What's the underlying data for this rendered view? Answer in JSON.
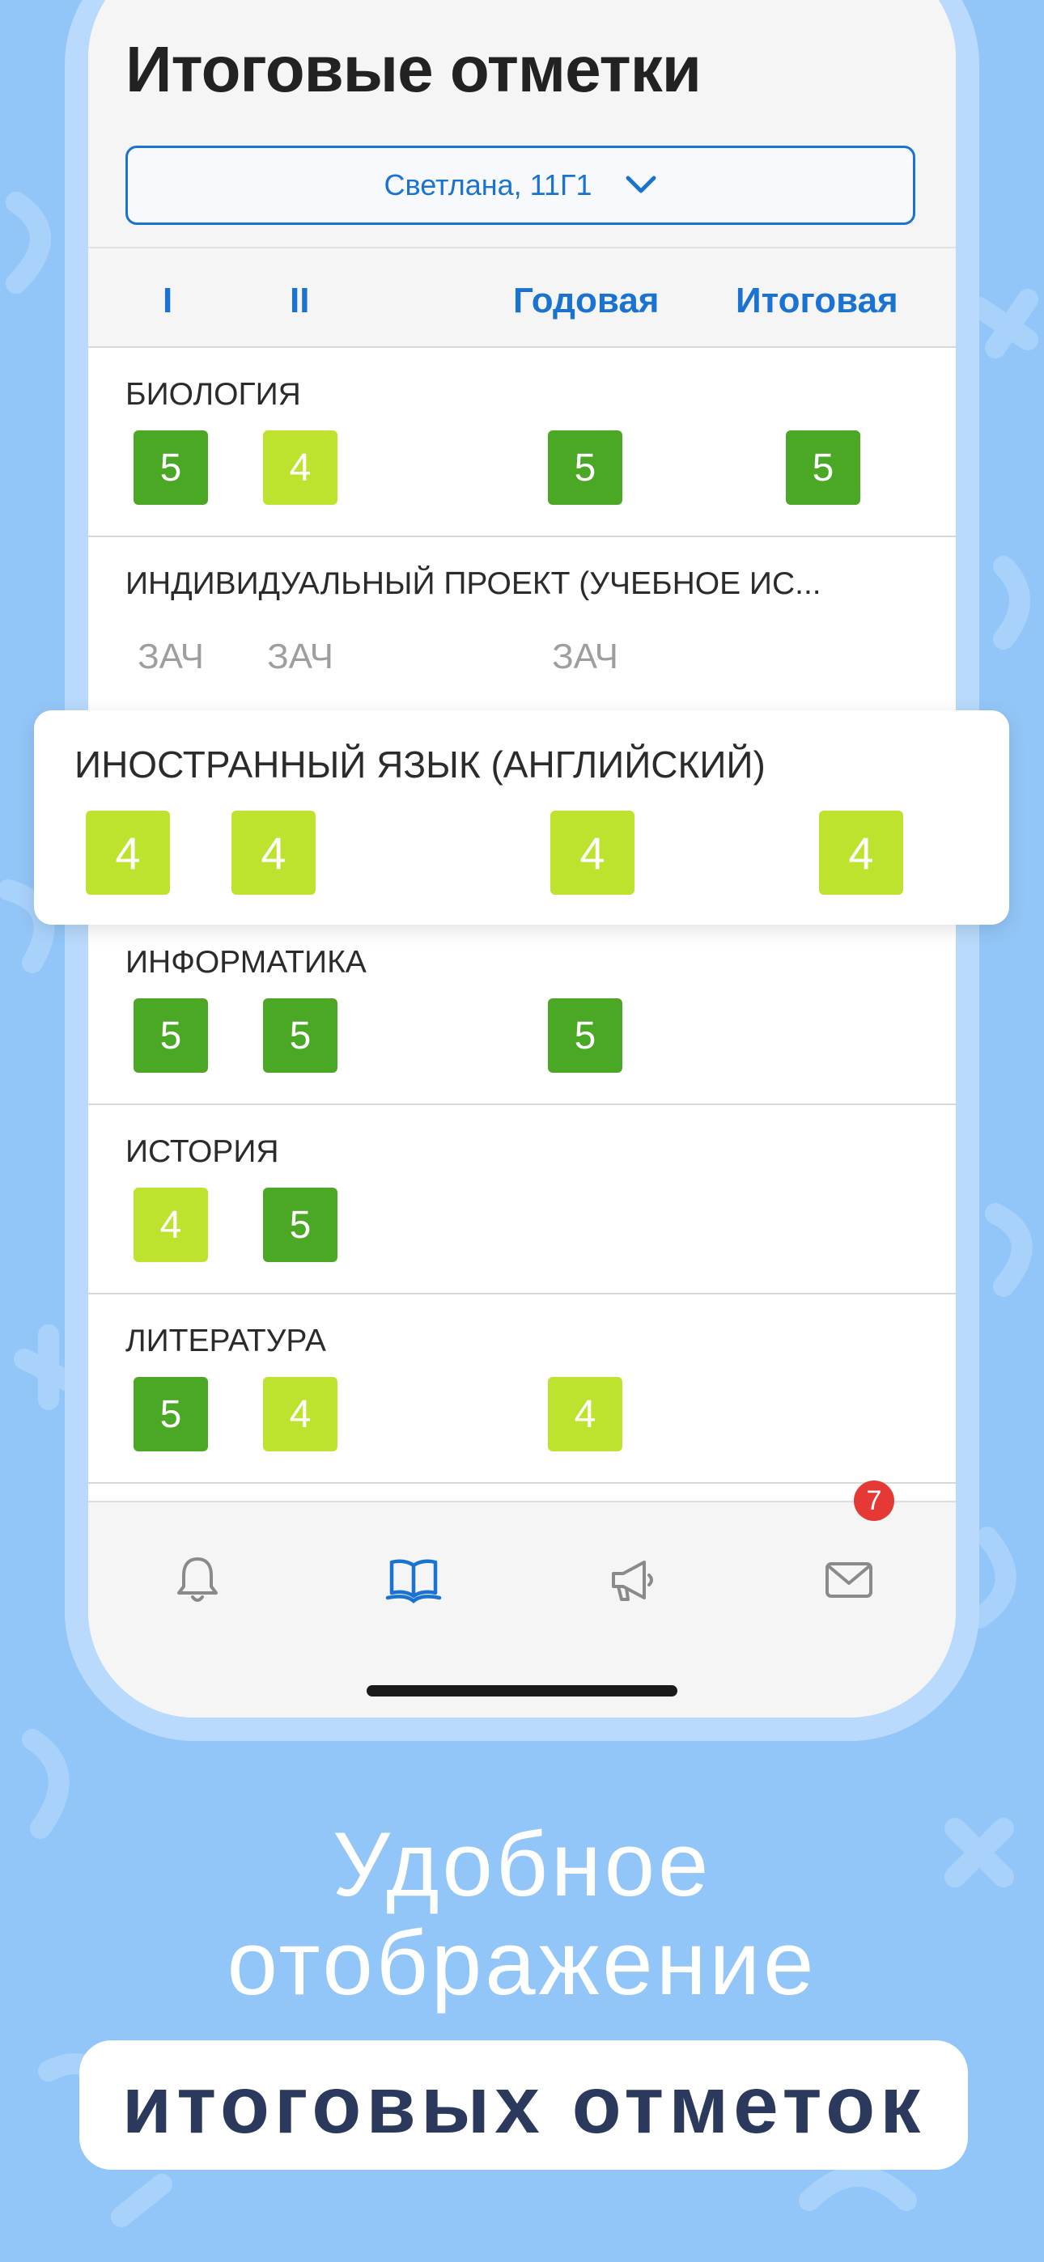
{
  "colors": {
    "background": "#93c6f8",
    "accent": "#1a73d0",
    "grade_5": "#4aa824",
    "grade_4": "#bde32f",
    "badge": "#e53935"
  },
  "header": {
    "title": "Итоговые отметки",
    "student_select": "Светлана, 11Г1"
  },
  "columns": [
    "I",
    "II",
    "Годовая",
    "Итоговая"
  ],
  "subjects": [
    {
      "name": "БИОЛОГИЯ",
      "grades": [
        "5",
        "4",
        "5",
        "5"
      ]
    },
    {
      "name": "ИНДИВИДУАЛЬНЫЙ ПРОЕКТ (УЧЕБНОЕ ИС...",
      "grades": [
        "ЗАЧ",
        "ЗАЧ",
        "ЗАЧ",
        ""
      ]
    },
    {
      "name": "ИНОСТРАННЫЙ ЯЗЫК (АНГЛИЙСКИЙ)",
      "grades": [
        "4",
        "4",
        "4",
        "4"
      ]
    },
    {
      "name": "ИНФОРМАТИКА",
      "grades": [
        "5",
        "5",
        "5",
        ""
      ]
    },
    {
      "name": "ИСТОРИЯ",
      "grades": [
        "4",
        "5",
        "",
        ""
      ]
    },
    {
      "name": "ЛИТЕРАТУРА",
      "grades": [
        "5",
        "4",
        "4",
        ""
      ]
    }
  ],
  "tabbar": {
    "icons": [
      "bell-icon",
      "book-icon",
      "megaphone-icon",
      "mail-icon"
    ],
    "active_tab": "book-icon",
    "mail_badge": "7"
  },
  "promo": {
    "line1": "Удобное",
    "line2": "отображение",
    "line3": "итоговых отметок"
  }
}
